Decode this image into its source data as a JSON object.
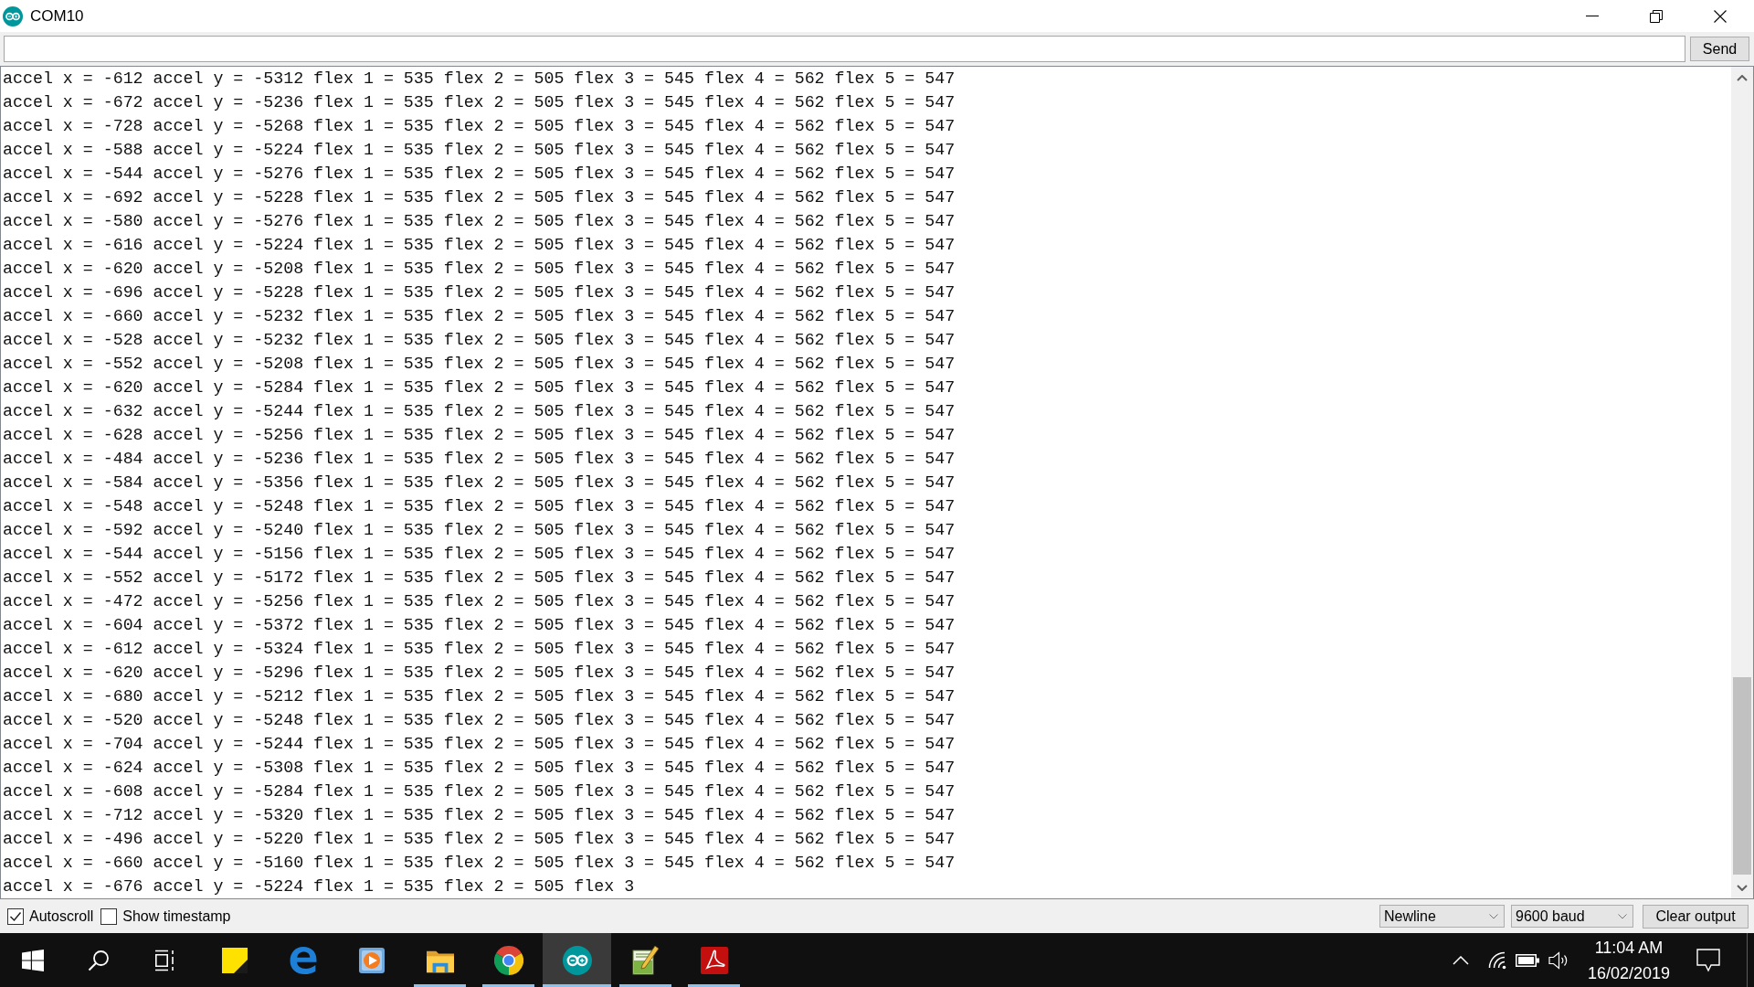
{
  "window": {
    "title": "COM10"
  },
  "send_bar": {
    "button": "Send"
  },
  "output_lines": [
    "accel x = -612 accel y = -5312 flex 1 = 535 flex 2 = 505 flex 3 = 545 flex 4 = 562 flex 5 = 547",
    "accel x = -672 accel y = -5236 flex 1 = 535 flex 2 = 505 flex 3 = 545 flex 4 = 562 flex 5 = 547",
    "accel x = -728 accel y = -5268 flex 1 = 535 flex 2 = 505 flex 3 = 545 flex 4 = 562 flex 5 = 547",
    "accel x = -588 accel y = -5224 flex 1 = 535 flex 2 = 505 flex 3 = 545 flex 4 = 562 flex 5 = 547",
    "accel x = -544 accel y = -5276 flex 1 = 535 flex 2 = 505 flex 3 = 545 flex 4 = 562 flex 5 = 547",
    "accel x = -692 accel y = -5228 flex 1 = 535 flex 2 = 505 flex 3 = 545 flex 4 = 562 flex 5 = 547",
    "accel x = -580 accel y = -5276 flex 1 = 535 flex 2 = 505 flex 3 = 545 flex 4 = 562 flex 5 = 547",
    "accel x = -616 accel y = -5224 flex 1 = 535 flex 2 = 505 flex 3 = 545 flex 4 = 562 flex 5 = 547",
    "accel x = -620 accel y = -5208 flex 1 = 535 flex 2 = 505 flex 3 = 545 flex 4 = 562 flex 5 = 547",
    "accel x = -696 accel y = -5228 flex 1 = 535 flex 2 = 505 flex 3 = 545 flex 4 = 562 flex 5 = 547",
    "accel x = -660 accel y = -5232 flex 1 = 535 flex 2 = 505 flex 3 = 545 flex 4 = 562 flex 5 = 547",
    "accel x = -528 accel y = -5232 flex 1 = 535 flex 2 = 505 flex 3 = 545 flex 4 = 562 flex 5 = 547",
    "accel x = -552 accel y = -5208 flex 1 = 535 flex 2 = 505 flex 3 = 545 flex 4 = 562 flex 5 = 547",
    "accel x = -620 accel y = -5284 flex 1 = 535 flex 2 = 505 flex 3 = 545 flex 4 = 562 flex 5 = 547",
    "accel x = -632 accel y = -5244 flex 1 = 535 flex 2 = 505 flex 3 = 545 flex 4 = 562 flex 5 = 547",
    "accel x = -628 accel y = -5256 flex 1 = 535 flex 2 = 505 flex 3 = 545 flex 4 = 562 flex 5 = 547",
    "accel x = -484 accel y = -5236 flex 1 = 535 flex 2 = 505 flex 3 = 545 flex 4 = 562 flex 5 = 547",
    "accel x = -584 accel y = -5356 flex 1 = 535 flex 2 = 505 flex 3 = 545 flex 4 = 562 flex 5 = 547",
    "accel x = -548 accel y = -5248 flex 1 = 535 flex 2 = 505 flex 3 = 545 flex 4 = 562 flex 5 = 547",
    "accel x = -592 accel y = -5240 flex 1 = 535 flex 2 = 505 flex 3 = 545 flex 4 = 562 flex 5 = 547",
    "accel x = -544 accel y = -5156 flex 1 = 535 flex 2 = 505 flex 3 = 545 flex 4 = 562 flex 5 = 547",
    "accel x = -552 accel y = -5172 flex 1 = 535 flex 2 = 505 flex 3 = 545 flex 4 = 562 flex 5 = 547",
    "accel x = -472 accel y = -5256 flex 1 = 535 flex 2 = 505 flex 3 = 545 flex 4 = 562 flex 5 = 547",
    "accel x = -604 accel y = -5372 flex 1 = 535 flex 2 = 505 flex 3 = 545 flex 4 = 562 flex 5 = 547",
    "accel x = -612 accel y = -5324 flex 1 = 535 flex 2 = 505 flex 3 = 545 flex 4 = 562 flex 5 = 547",
    "accel x = -620 accel y = -5296 flex 1 = 535 flex 2 = 505 flex 3 = 545 flex 4 = 562 flex 5 = 547",
    "accel x = -680 accel y = -5212 flex 1 = 535 flex 2 = 505 flex 3 = 545 flex 4 = 562 flex 5 = 547",
    "accel x = -520 accel y = -5248 flex 1 = 535 flex 2 = 505 flex 3 = 545 flex 4 = 562 flex 5 = 547",
    "accel x = -704 accel y = -5244 flex 1 = 535 flex 2 = 505 flex 3 = 545 flex 4 = 562 flex 5 = 547",
    "accel x = -624 accel y = -5308 flex 1 = 535 flex 2 = 505 flex 3 = 545 flex 4 = 562 flex 5 = 547",
    "accel x = -608 accel y = -5284 flex 1 = 535 flex 2 = 505 flex 3 = 545 flex 4 = 562 flex 5 = 547",
    "accel x = -712 accel y = -5320 flex 1 = 535 flex 2 = 505 flex 3 = 545 flex 4 = 562 flex 5 = 547",
    "accel x = -496 accel y = -5220 flex 1 = 535 flex 2 = 505 flex 3 = 545 flex 4 = 562 flex 5 = 547",
    "accel x = -660 accel y = -5160 flex 1 = 535 flex 2 = 505 flex 3 = 545 flex 4 = 562 flex 5 = 547",
    "accel x = -676 accel y = -5224 flex 1 = 535 flex 2 = 505 flex 3"
  ],
  "footer": {
    "options": [
      {
        "label": "Autoscroll",
        "checked": true
      },
      {
        "label": "Show timestamp",
        "checked": false
      }
    ],
    "line_ending": "Newline",
    "baud_rate": "9600 baud",
    "clear_button": "Clear output"
  },
  "taskbar": {
    "apps": [
      {
        "kind": "start",
        "running": false,
        "selected": false
      },
      {
        "kind": "search",
        "running": false,
        "selected": false
      },
      {
        "kind": "taskview",
        "running": false,
        "selected": false
      },
      {
        "kind": "notes",
        "running": false,
        "selected": false
      },
      {
        "kind": "edge",
        "running": false,
        "selected": false
      },
      {
        "kind": "media",
        "running": false,
        "selected": false
      },
      {
        "kind": "folder",
        "running": true,
        "selected": false
      },
      {
        "kind": "chrome",
        "running": true,
        "selected": false
      },
      {
        "kind": "arduino",
        "running": true,
        "selected": true
      },
      {
        "kind": "notepad",
        "running": true,
        "selected": false
      },
      {
        "kind": "pdf",
        "running": true,
        "selected": false
      }
    ],
    "tray": {
      "time": "11:04 AM",
      "date": "16/02/2019"
    }
  }
}
